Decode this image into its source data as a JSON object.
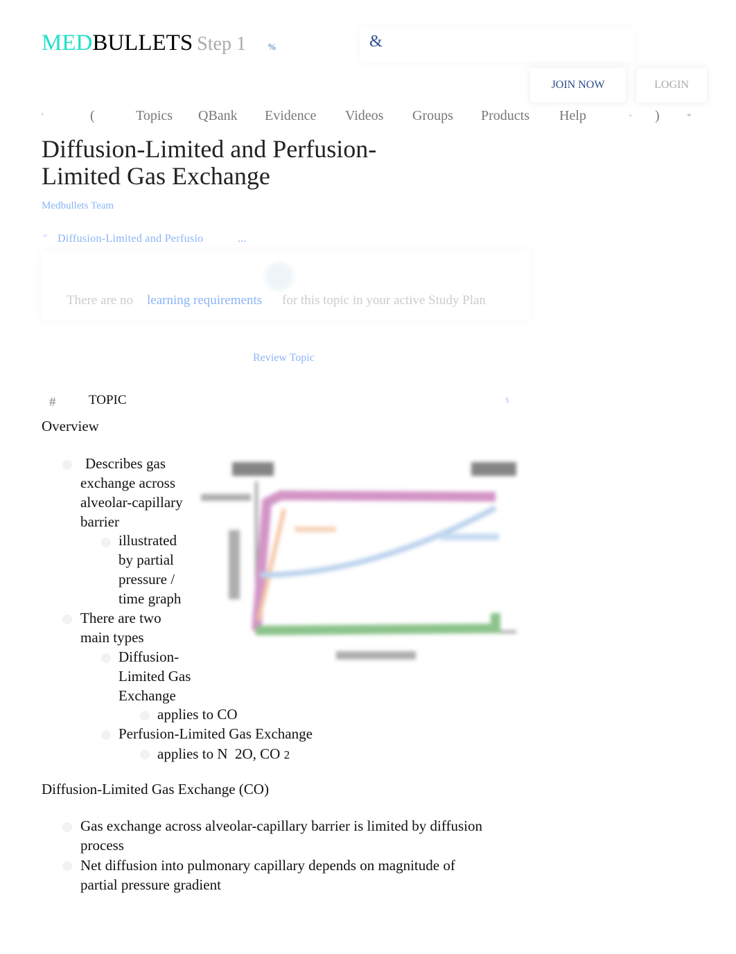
{
  "header": {
    "logo_med": "MED",
    "logo_bullets": "BULLETS",
    "logo_step": "Step 1",
    "percent_glyph": "%",
    "search_icon": "search-icon",
    "search_glyph": "&",
    "join_label": "JOIN NOW",
    "login_label": "LOGIN"
  },
  "nav": {
    "left_glyphs": [
      "'",
      "("
    ],
    "items": [
      "Topics",
      "QBank",
      "Evidence",
      "Videos",
      "Groups",
      "Products",
      "Help"
    ],
    "right_glyphs": [
      "+",
      ")",
      "*"
    ]
  },
  "page": {
    "title": "Diffusion-Limited and Perfusion-Limited Gas Exchange",
    "author": "Medbullets Team",
    "breadcrumb_glyph": "\"",
    "breadcrumb": "Diffusion-Limited and Perfusio",
    "breadcrumb_ellipsis": "...",
    "study_plan": {
      "prefix": "There are no",
      "link": "learning requirements",
      "suffix": "for this topic in your active Study Plan"
    },
    "review_topic": "Review Topic",
    "topic_glyph": "#",
    "topic_label": "TOPIC",
    "topic_right_glyph": "$"
  },
  "content": {
    "overview_heading": "Overview",
    "overview": {
      "b1": "Describes gas exchange across alveolar-capillary barrier",
      "b1_sub": "illustrated by partial pressure / time graph",
      "b2": "There are two main types",
      "b2_sub1": "Diffusion-Limited Gas Exchange",
      "b2_sub1_sub": "applies to CO",
      "b2_sub2": "Perfusion-Limited Gas Exchange",
      "b2_sub2_sub_prefix": "applies to N",
      "b2_sub2_sub_mid": "2O, CO",
      "b2_sub2_sub_suffix": "2"
    },
    "diffusion_heading": "Diffusion-Limited Gas Exchange (CO)",
    "diffusion": [
      "Gas exchange across alveolar-capillary barrier is limited by diffusion process",
      "Net diffusion into pulmonary capillary depends on magnitude of partial pressure gradient"
    ]
  },
  "colors": {
    "logo_accent": "#1ee0c8",
    "link": "#8ab4f8",
    "nav_blue": "#2b4d8c"
  }
}
